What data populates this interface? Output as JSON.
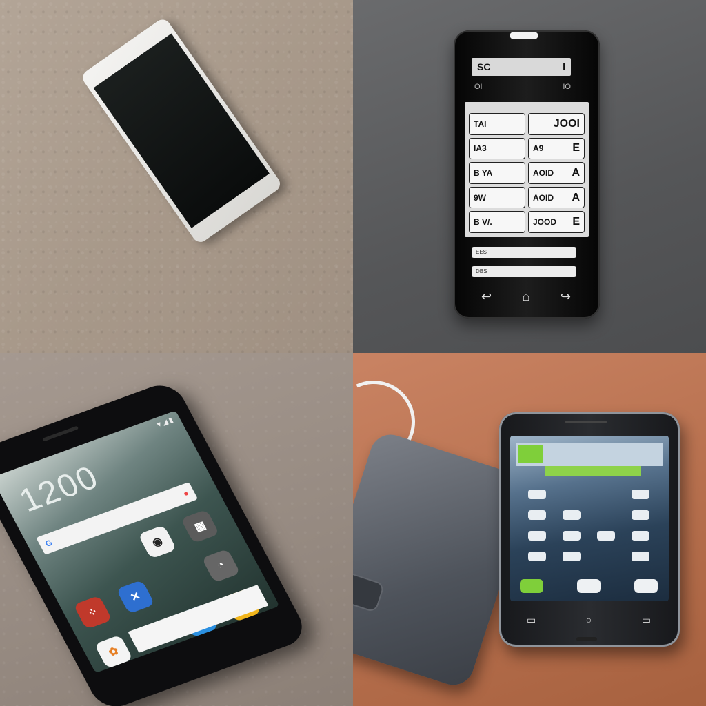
{
  "panels": {
    "p2": {
      "header_left": "SC",
      "header_right": "l",
      "sub_left": "OI",
      "sub_right": "IO",
      "keys": [
        {
          "left": "TAI",
          "right": ""
        },
        {
          "left": "",
          "right": "JOOI"
        },
        {
          "left": "IA3",
          "right": ""
        },
        {
          "left": "A9",
          "right": "E"
        },
        {
          "left": "B YA",
          "right": ""
        },
        {
          "left": "AOID",
          "right": "A"
        },
        {
          "left": "9W",
          "right": ""
        },
        {
          "left": "AOID",
          "right": "A"
        },
        {
          "left": "B V/.",
          "right": ""
        },
        {
          "left": "JOOD",
          "right": "E"
        }
      ],
      "bar1": "EES",
      "bar2": "DBS"
    },
    "p3": {
      "clock": "1200",
      "status": "▼◢ ▮"
    }
  }
}
